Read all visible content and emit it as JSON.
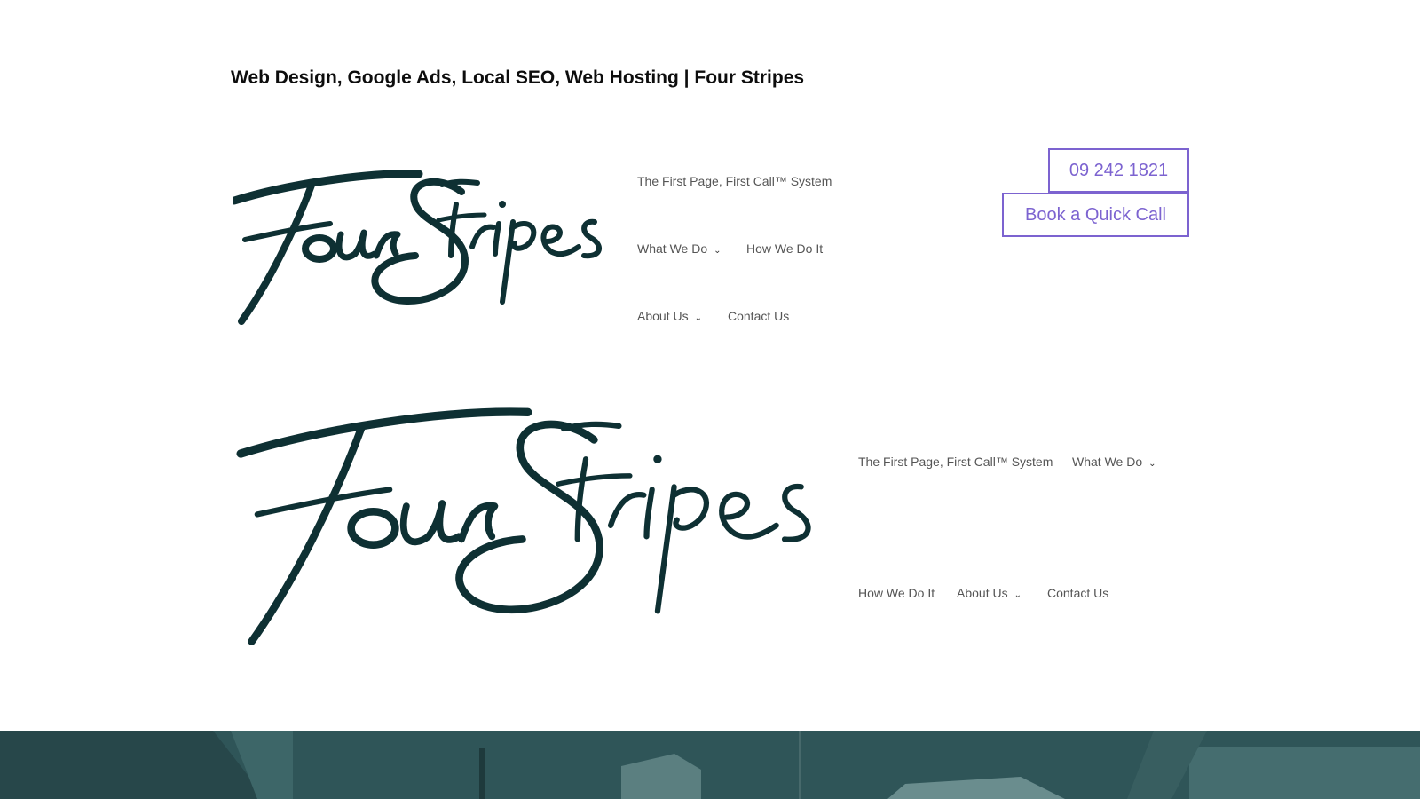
{
  "site": {
    "title": "Web Design, Google Ads, Local SEO, Web Hosting | Four Stripes",
    "logo_text": "Four Stripes"
  },
  "header_primary": {
    "nav": [
      {
        "label": "The First Page, First Call™ System"
      },
      {
        "label": "What We Do",
        "icon": "chevron-down-icon"
      },
      {
        "label": "How We Do It"
      },
      {
        "label": "About Us",
        "icon": "chevron-down-icon"
      },
      {
        "label": "Contact Us"
      }
    ],
    "phone_button": "09 242 1821",
    "book_button": "Book a Quick Call"
  },
  "header_secondary": {
    "nav": [
      {
        "label": "The First Page, First Call™ System"
      },
      {
        "label": "What We Do",
        "icon": "chevron-down-icon"
      },
      {
        "label": "How We Do It"
      },
      {
        "label": "About Us",
        "icon": "chevron-down-icon"
      },
      {
        "label": "Contact Us"
      }
    ]
  },
  "colors": {
    "logo": "#0e3033",
    "accent": "#7c63d0",
    "nav_text": "#555555",
    "hero_overlay": "#2f5558"
  }
}
